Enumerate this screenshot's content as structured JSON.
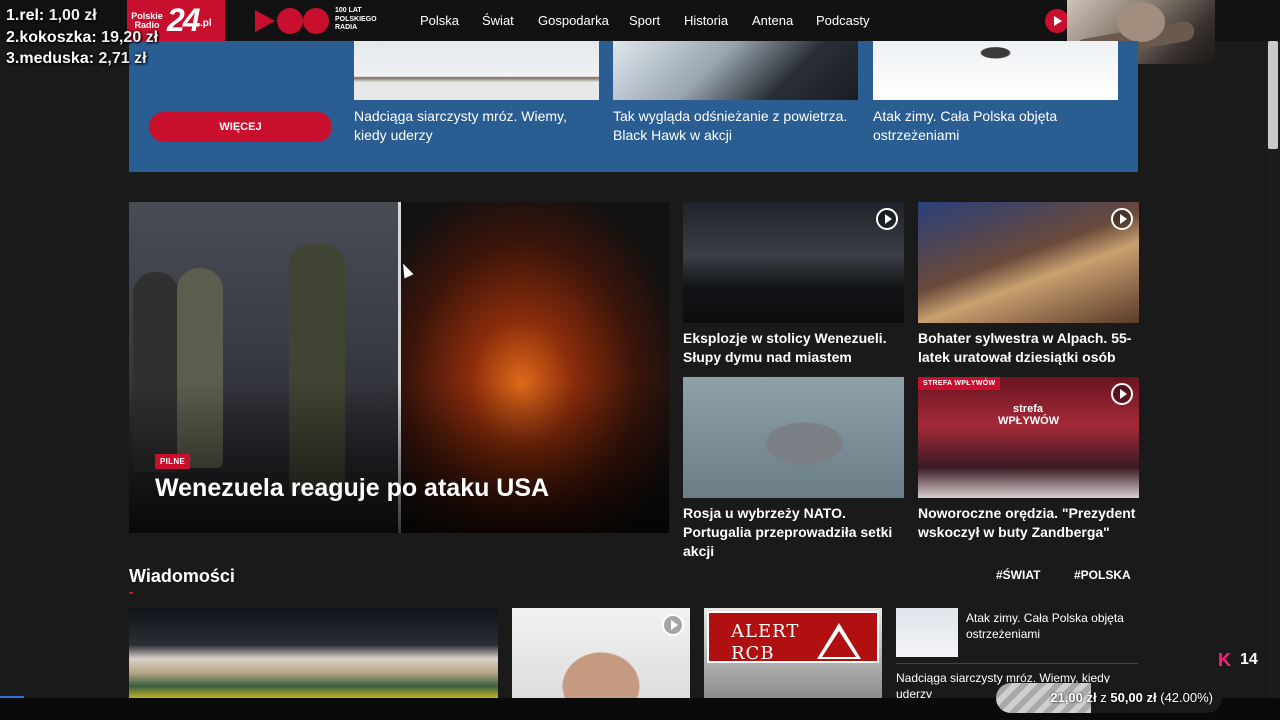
{
  "ranking": [
    {
      "rank": "1.",
      "name": "rel:",
      "amount": "1,00 zł"
    },
    {
      "rank": "2.",
      "name": "kokoszka:",
      "amount": "19,20 zł"
    },
    {
      "rank": "3.",
      "name": "meduska:",
      "amount": "2,71 zł"
    }
  ],
  "logo": {
    "line1": "Polskie",
    "line2": "Radio",
    "num": "24",
    "suffix": ".pl"
  },
  "anniversary": {
    "line1": "100 LAT",
    "line2": "POLSKIEGO",
    "line3": "RADIA"
  },
  "nav": [
    "Polska",
    "Świat",
    "Gospodarka",
    "Sport",
    "Historia",
    "Antena",
    "Podcasty"
  ],
  "promo": {
    "more_label": "WIĘCEJ",
    "cards": [
      {
        "title": "Nadciąga siarczysty mróz. Wiemy, kiedy uderzy"
      },
      {
        "title": "Tak wygląda odśnieżanie z powietrza. Black Hawk w akcji"
      },
      {
        "title": "Atak zimy. Cała Polska objęta ostrzeżeniami"
      }
    ]
  },
  "hero": {
    "badge": "PILNE",
    "title": "Wenezuela reaguje po ataku USA"
  },
  "tiles": [
    {
      "title": "Eksplozje w stolicy Wenezueli. Słupy dymu nad miastem"
    },
    {
      "title": "Bohater sylwestra w Alpach. 55-latek uratował dziesiątki osób"
    },
    {
      "title": "Rosja u wybrzeży NATO. Portugalia przeprowadziła setki akcji"
    },
    {
      "title": "Noworoczne orędzia. \"Prezydent wskoczył w buty Zandberga\"",
      "badge": "STREFA WPŁYWÓW",
      "overlay": "strefa WPŁYWÓW"
    }
  ],
  "news": {
    "heading": "Wiadomości",
    "tags": [
      "#ŚWIAT",
      "#POLSKA"
    ],
    "alert_line1": "ALERT",
    "alert_line2": "RCB",
    "side": [
      {
        "title": "Atak zimy. Cała Polska objęta ostrzeżeniami"
      },
      {
        "title": "Nadciąga siarczysty mróz. Wiemy, kiedy uderzy"
      }
    ]
  },
  "donation_goal": {
    "current": "21,00 zł",
    "sep": "z",
    "target": "50,00 zł",
    "percent_label": "(42.00%)",
    "fraction": 0.42
  },
  "viewers": {
    "count": "14"
  },
  "colors": {
    "brand_red": "#c8102e",
    "promo_blue": "#2a5d92",
    "kick_pink": "#ff1f7e"
  }
}
